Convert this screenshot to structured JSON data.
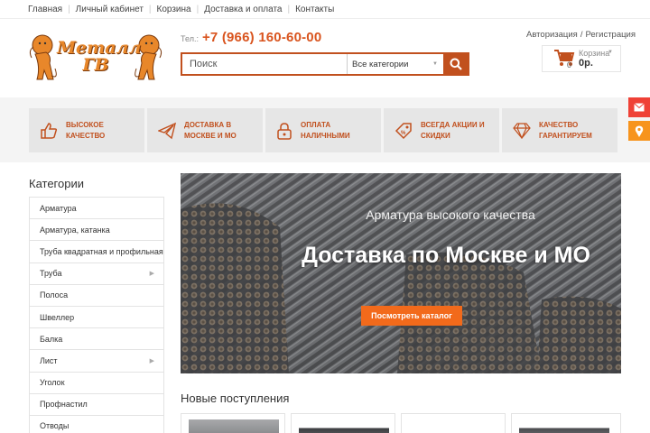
{
  "topnav": {
    "items": [
      "Главная",
      "Личный кабинет",
      "Корзина",
      "Доставка и оплата",
      "Контакты"
    ]
  },
  "logo": {
    "text_line1": "Металл",
    "text_line2": "ГВ",
    "color": "#e8872a"
  },
  "header": {
    "phone_label": "Тел.:",
    "phone": "+7 (966) 160-60-00",
    "auth_login": "Авторизация",
    "auth_sep": "/",
    "auth_register": "Регистрация"
  },
  "search": {
    "placeholder": "Поиск",
    "category_selected": "Все категории"
  },
  "cart": {
    "label": "Корзина",
    "count": "0",
    "sum": "0р."
  },
  "features": [
    {
      "line1": "Высокое",
      "line2": "качество",
      "icon": "thumbs-up-icon"
    },
    {
      "line1": "Доставка в",
      "line2": "Москве и МО",
      "icon": "paper-plane-icon"
    },
    {
      "line1": "Оплата",
      "line2": "наличными",
      "icon": "lock-icon"
    },
    {
      "line1": "Всегда акции и",
      "line2": "скидки",
      "icon": "tag-icon"
    },
    {
      "line1": "Качество",
      "line2": "гарантируем",
      "icon": "diamond-icon"
    }
  ],
  "categories": {
    "title": "Категории",
    "items": [
      {
        "label": "Арматура"
      },
      {
        "label": "Арматура, катанка"
      },
      {
        "label": "Труба квадратная и профильная"
      },
      {
        "label": "Труба",
        "has_sub": true
      },
      {
        "label": "Полоса"
      },
      {
        "label": "Швеллер"
      },
      {
        "label": "Балка"
      },
      {
        "label": "Лист",
        "has_sub": true
      },
      {
        "label": "Уголок"
      },
      {
        "label": "Профнастил"
      },
      {
        "label": "Отводы"
      }
    ]
  },
  "banner": {
    "subtitle": "Арматура высокого качества",
    "title": "Доставка по Москве и МО",
    "cta": "Посмотреть каталог"
  },
  "new_arrivals": {
    "title": "Новые поступления"
  },
  "colors": {
    "accent": "#c1501e",
    "phone": "#d9541e",
    "cta": "#f26a1b",
    "mail_btn": "#ef4136",
    "map_btn": "#f7941d"
  }
}
